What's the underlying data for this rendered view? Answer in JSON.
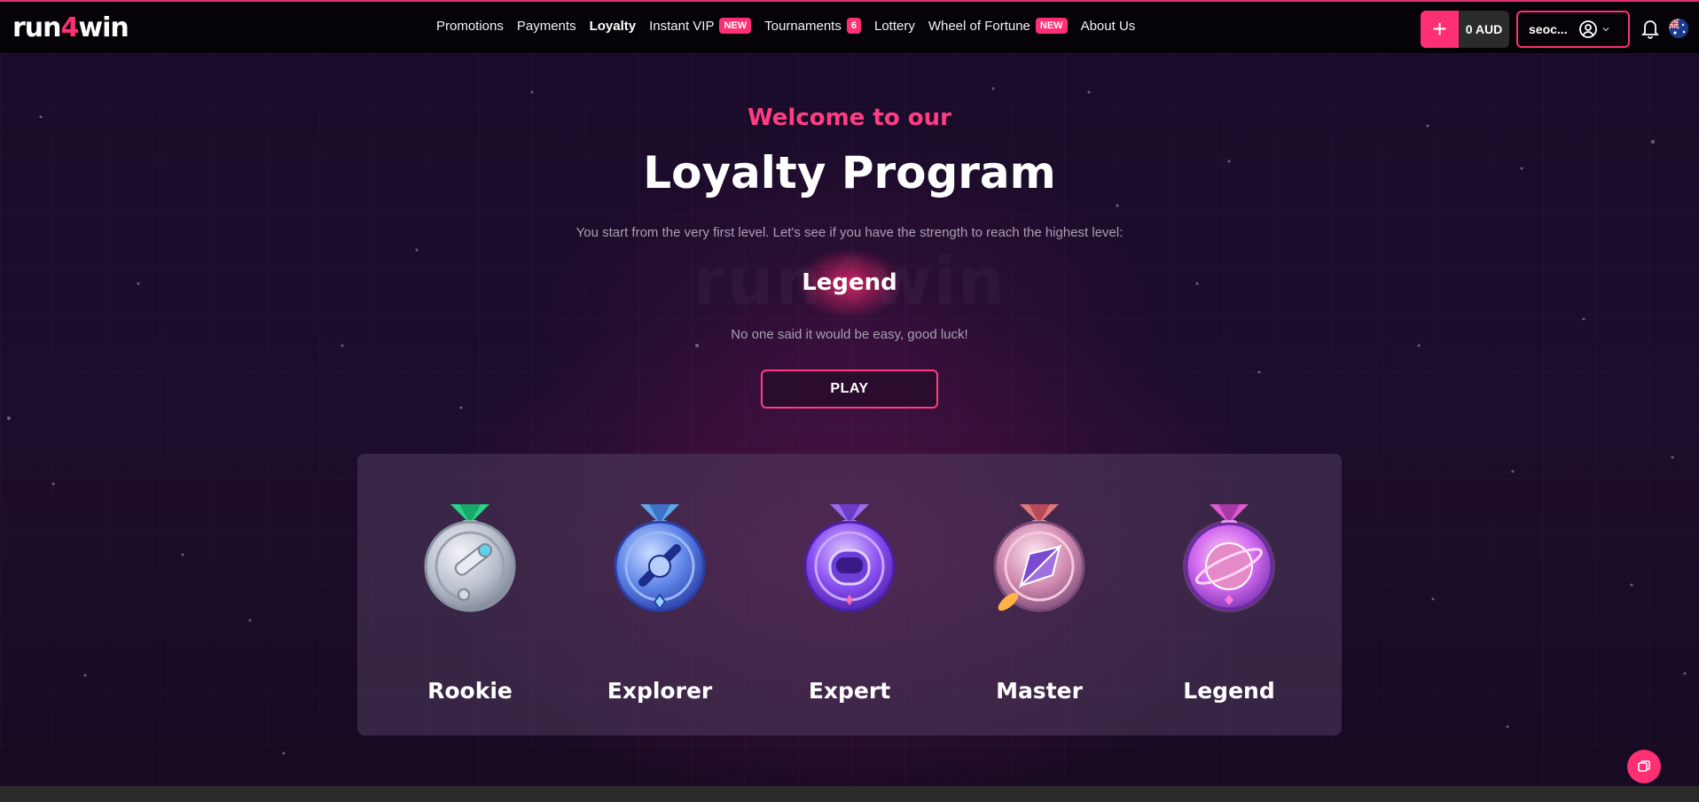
{
  "header": {
    "logo_prefix": "run",
    "logo_four": "4",
    "logo_suffix": "win",
    "nav": [
      {
        "label": "Promotions",
        "active": false
      },
      {
        "label": "Payments",
        "active": false
      },
      {
        "label": "Loyalty",
        "active": true
      },
      {
        "label": "Instant VIP",
        "badge": "NEW"
      },
      {
        "label": "Tournaments",
        "badge": "6"
      },
      {
        "label": "Lottery"
      },
      {
        "label": "Wheel of Fortune",
        "badge": "NEW"
      },
      {
        "label": "About Us"
      }
    ],
    "wallet": {
      "plus": "+",
      "balance": "0 AUD"
    },
    "user": {
      "name": "seoc..."
    },
    "icons": [
      "plus-icon",
      "user-circle-icon",
      "chevron-down-icon",
      "bell-icon",
      "australia-flag-icon"
    ]
  },
  "hero": {
    "welcome": "Welcome to our",
    "title": "Loyalty Program",
    "subtitle": "You start from the very first level. Let's see if you have the strength to reach the highest level:",
    "watermark": "run4win",
    "level": "Legend",
    "note": "No one said it would be easy, good luck!",
    "play_label": "PLAY"
  },
  "levels": [
    {
      "name": "Rookie",
      "icon": "rookie-medal-icon"
    },
    {
      "name": "Explorer",
      "icon": "explorer-medal-icon"
    },
    {
      "name": "Expert",
      "icon": "expert-medal-icon"
    },
    {
      "name": "Master",
      "icon": "master-medal-icon"
    },
    {
      "name": "Legend",
      "icon": "legend-medal-icon"
    }
  ],
  "colors": {
    "accent": "#ff2f74",
    "background": "#1a0b26",
    "header": "#050307",
    "panel": "#3a2c48"
  },
  "chat_icon": "chat-icon"
}
